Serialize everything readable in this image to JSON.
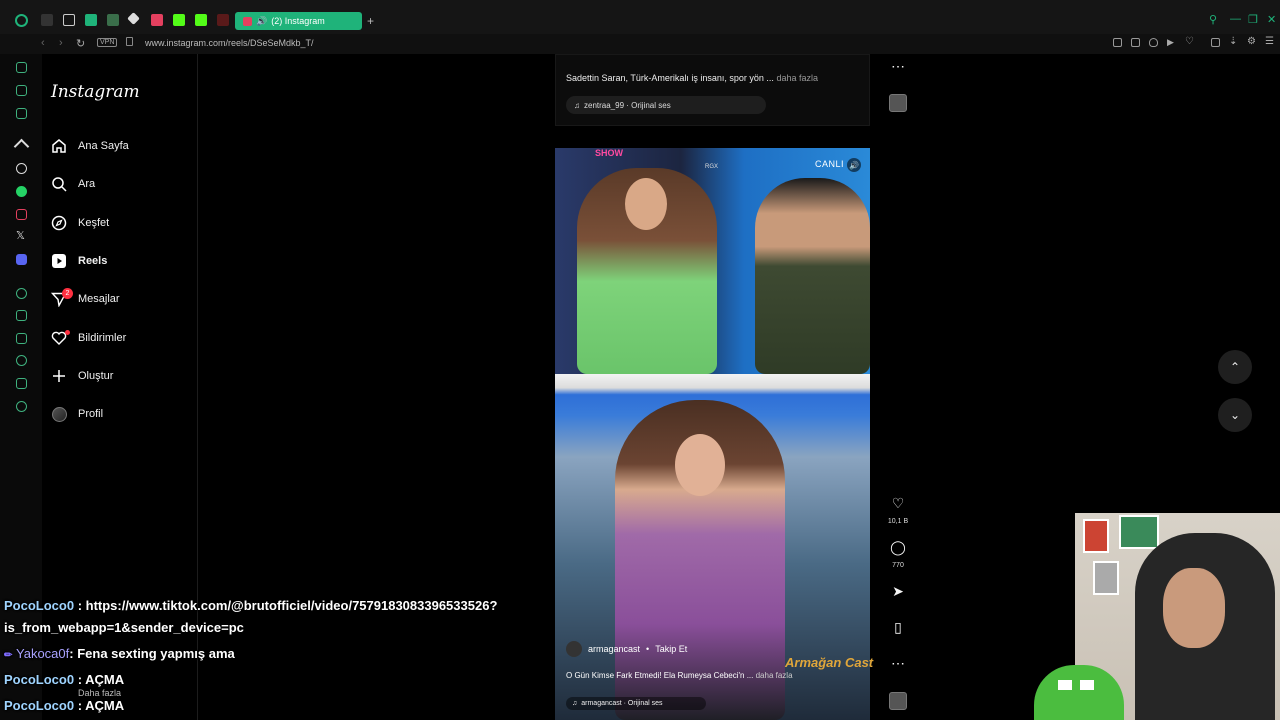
{
  "browser": {
    "tab_title": "(2) Instagram",
    "new_tab": "+",
    "url": "www.instagram.com/reels/DSeSeMdkb_T/",
    "vpn_label": "VPN"
  },
  "instagram": {
    "logo": "Instagram",
    "nav": [
      {
        "label": "Ana Sayfa",
        "icon": "home-icon"
      },
      {
        "label": "Ara",
        "icon": "search-icon"
      },
      {
        "label": "Keşfet",
        "icon": "compass-icon"
      },
      {
        "label": "Reels",
        "icon": "reels-icon"
      },
      {
        "label": "Mesajlar",
        "icon": "messenger-icon",
        "badge": "2"
      },
      {
        "label": "Bildirimler",
        "icon": "heart-icon"
      },
      {
        "label": "Oluştur",
        "icon": "plus-icon"
      },
      {
        "label": "Profil",
        "icon": "avatar-icon"
      }
    ]
  },
  "prev_post": {
    "caption": "Sadettin Saran, Türk-Amerikalı iş insanı, spor yön ...",
    "more": "daha fazla",
    "audio": "zentraa_99 · Orijinal ses"
  },
  "reel": {
    "overlay_show": "SHOW",
    "overlay_rgx": "RGX",
    "overlay_live": "CANLI",
    "username": "armagancast",
    "follow": "Takip Et",
    "caption": "O Gün Kimse Fark Etmedi! Ela Rumeysa Cebeci'n ...",
    "more": "daha fazla",
    "audio": "armagancast · Orijinal ses",
    "watermark": "Armağan Cast",
    "likes": "10,1 B",
    "comments": "770"
  },
  "chat": [
    {
      "user": "PocoLoco0",
      "sep": " : ",
      "msg": "https://www.tiktok.com/@brutofficiel/video/7579183083396533526?"
    },
    {
      "user": "",
      "sep": "",
      "msg": "is_from_webapp=1&sender_device=pc"
    },
    {
      "user": "Yakoca0f",
      "sep": ": ",
      "msg": "Fena sexting yapmış ama"
    },
    {
      "user": "PocoLoco0",
      "sep": " : ",
      "msg": "AÇMA"
    },
    {
      "user": "PocoLoco0",
      "sep": " : ",
      "msg": "AÇMA"
    }
  ],
  "underlay_text": "Daha fazla",
  "colors": {
    "accent": "#1fb37a",
    "badge": "#ff3040",
    "frame": "#d4e600"
  }
}
